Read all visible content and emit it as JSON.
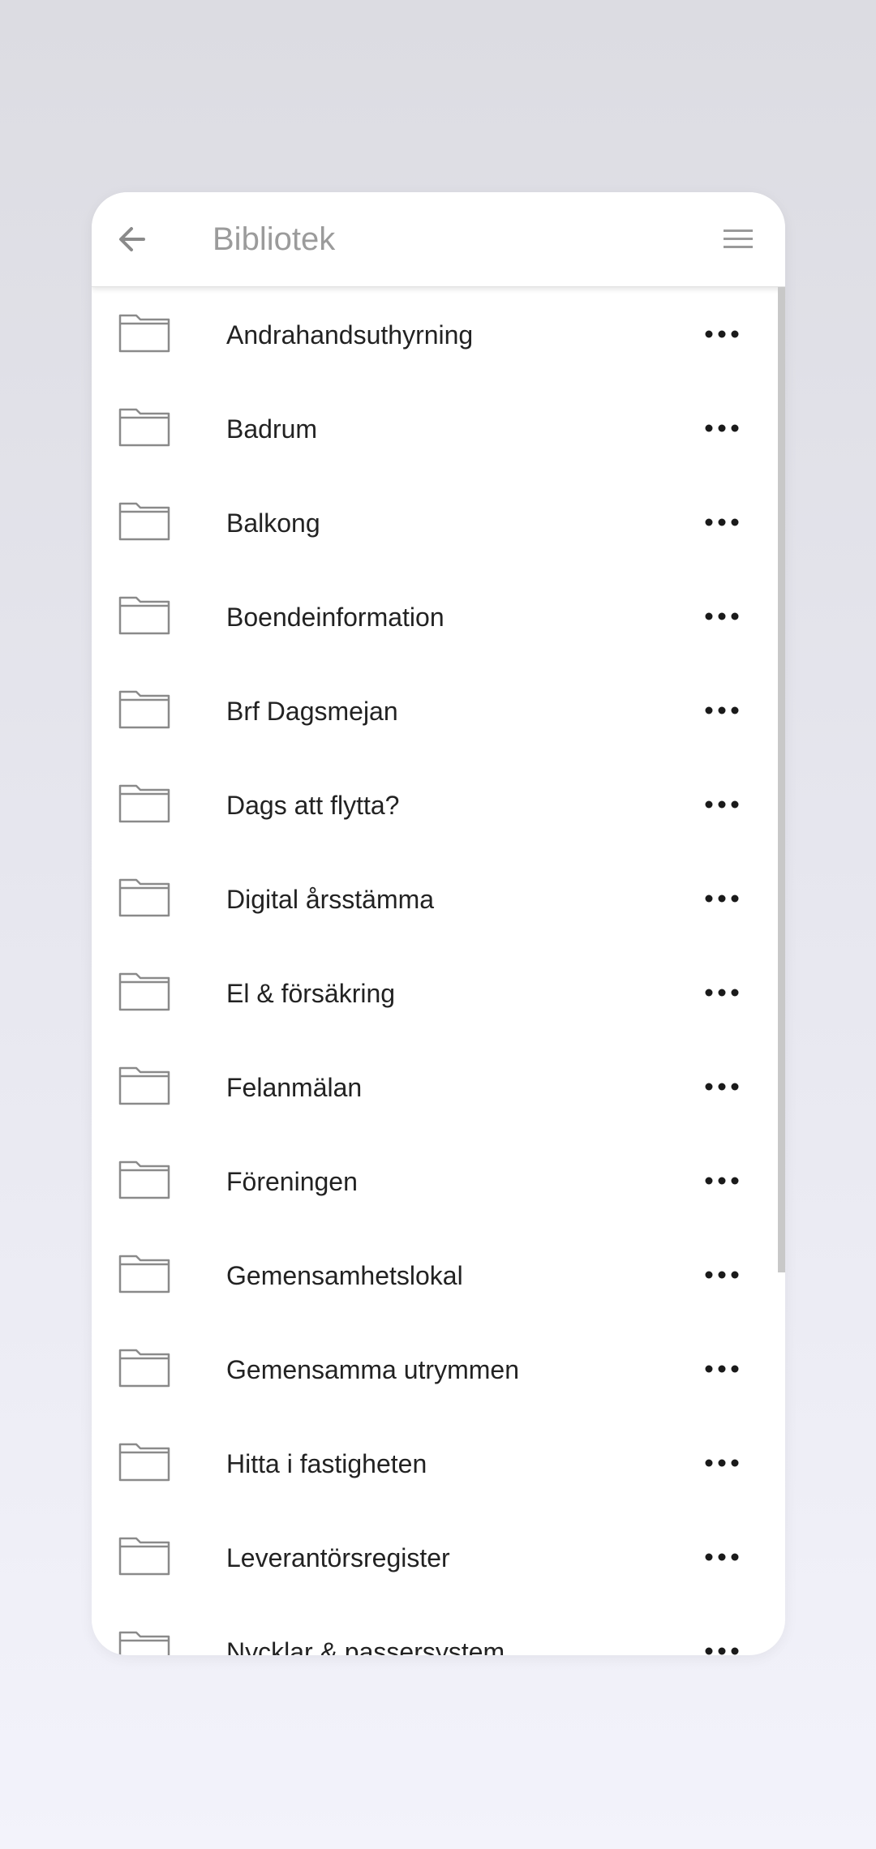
{
  "header": {
    "title": "Bibliotek",
    "back_icon": "arrow-left-icon",
    "menu_icon": "hamburger-menu-icon"
  },
  "library": {
    "folder_icon": "folder-icon",
    "more_icon": "more-horizontal-icon",
    "items": [
      {
        "label": "Andrahandsuthyrning"
      },
      {
        "label": "Badrum"
      },
      {
        "label": "Balkong"
      },
      {
        "label": "Boendeinformation"
      },
      {
        "label": "Brf Dagsmejan"
      },
      {
        "label": "Dags att flytta?"
      },
      {
        "label": "Digital årsstämma"
      },
      {
        "label": "El & försäkring"
      },
      {
        "label": "Felanmälan"
      },
      {
        "label": "Föreningen"
      },
      {
        "label": "Gemensamhetslokal"
      },
      {
        "label": "Gemensamma utrymmen"
      },
      {
        "label": "Hitta i fastigheten"
      },
      {
        "label": "Leverantörsregister"
      },
      {
        "label": "Nycklar & passersystem"
      }
    ]
  },
  "colors": {
    "background_top": "#dcdce2",
    "background_bottom": "#f3f3fb",
    "card": "#ffffff",
    "title_text": "#9b9b9b",
    "item_text": "#222222",
    "icon_stroke": "#8a8a8a"
  }
}
